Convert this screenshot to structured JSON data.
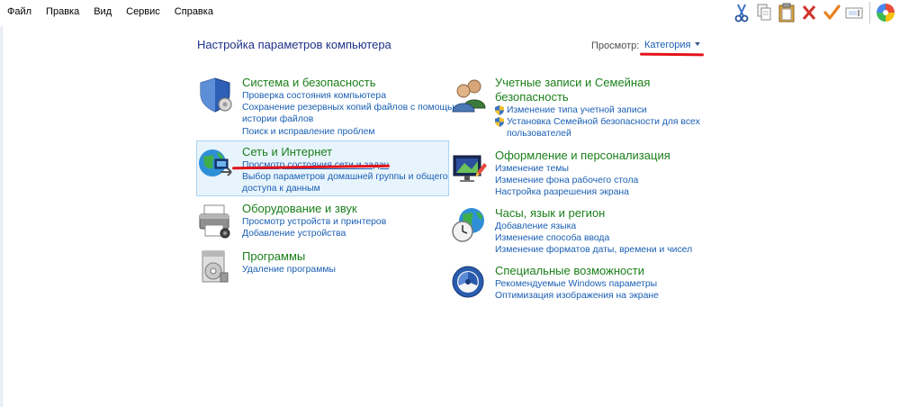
{
  "menu": [
    "Файл",
    "Правка",
    "Вид",
    "Сервис",
    "Справка"
  ],
  "toolbar": {
    "tools": [
      "scissors-icon",
      "copy-icon",
      "paste-icon",
      "delete-icon",
      "check-icon",
      "rename-icon",
      "flower-icon"
    ]
  },
  "page": {
    "title": "Настройка параметров компьютера",
    "view_label": "Просмотр:",
    "view_value": "Категория"
  },
  "categories": {
    "security": {
      "title": "Система и безопасность",
      "links": [
        "Проверка состояния компьютера",
        "Сохранение резервных копий файлов с помощью",
        "истории файлов",
        "Поиск и исправление проблем"
      ]
    },
    "network": {
      "title": "Сеть и Интернет",
      "links": [
        "Просмотр состояния сети и задач",
        "Выбор параметров домашней группы и общего",
        "доступа к данным"
      ]
    },
    "hardware": {
      "title": "Оборудование и звук",
      "links": [
        "Просмотр устройств и принтеров",
        "Добавление устройства"
      ]
    },
    "programs": {
      "title": "Программы",
      "links": [
        "Удаление программы"
      ]
    },
    "accounts": {
      "title_line1": "Учетные записи и Семейная",
      "title_line2": "безопасность",
      "links": [
        "Изменение типа учетной записи",
        "Установка Семейной безопасности для всех",
        "пользователей"
      ]
    },
    "appearance": {
      "title": "Оформление и персонализация",
      "links": [
        "Изменение темы",
        "Изменение фона рабочего стола",
        "Настройка разрешения экрана"
      ]
    },
    "clock": {
      "title": "Часы, язык и регион",
      "links": [
        "Добавление языка",
        "Изменение способа ввода",
        "Изменение форматов даты, времени и чисел"
      ]
    },
    "access": {
      "title": "Специальные возможности",
      "links": [
        "Рекомендуемые Windows параметры",
        "Оптимизация изображения на экране"
      ]
    }
  },
  "colors": {
    "link": "#1a5fb4",
    "category_title": "#1a7f1a",
    "annotation_red": "#e3141b",
    "highlight_bg": "#e8f4fc"
  }
}
